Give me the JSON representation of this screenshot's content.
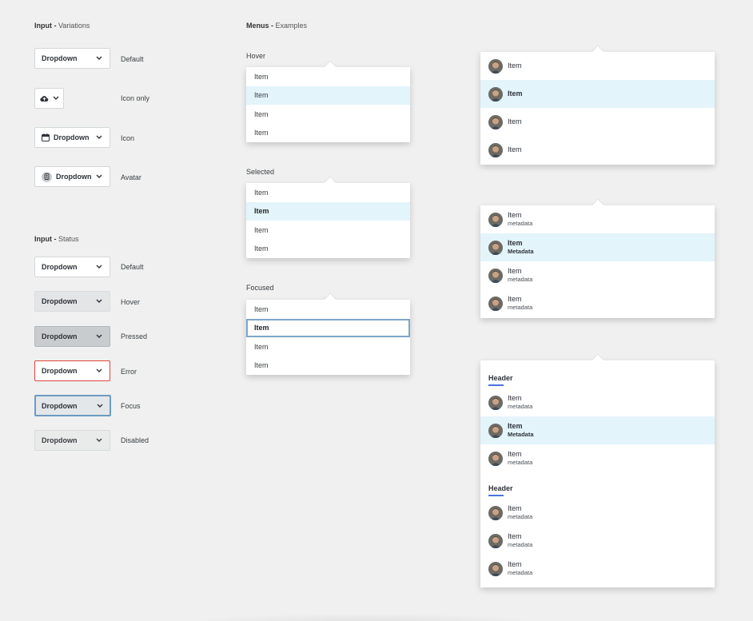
{
  "variations": {
    "title_bold": "Input -",
    "title_rest": " Variations",
    "items": [
      {
        "label": "Default",
        "value": "Dropdown"
      },
      {
        "label": "Icon only",
        "value": ""
      },
      {
        "label": "Icon",
        "value": "Dropdown"
      },
      {
        "label": "Avatar",
        "value": "Dropdown"
      }
    ]
  },
  "status": {
    "title_bold": "Input -",
    "title_rest": " Status",
    "items": [
      {
        "label": "Default",
        "value": "Dropdown",
        "state": "default"
      },
      {
        "label": "Hover",
        "value": "Dropdown",
        "state": "hover"
      },
      {
        "label": "Pressed",
        "value": "Dropdown",
        "state": "pressed"
      },
      {
        "label": "Error",
        "value": "Dropdown",
        "state": "error"
      },
      {
        "label": "Focus",
        "value": "Dropdown",
        "state": "focus"
      },
      {
        "label": "Disabled",
        "value": "Dropdown",
        "state": "disabled"
      }
    ]
  },
  "menus": {
    "title_bold": "Menus -",
    "title_rest": " Examples",
    "hover": {
      "label": "Hover",
      "items": [
        "Item",
        "Item",
        "Item",
        "Item"
      ]
    },
    "selected": {
      "label": "Selected",
      "items": [
        "Item",
        "Item",
        "Item",
        "Item"
      ]
    },
    "focused": {
      "label": "Focused",
      "items": [
        "Item",
        "Item",
        "Item",
        "Item"
      ]
    }
  },
  "avatar_menu": {
    "items": [
      "Item",
      "Item",
      "Item",
      "Item"
    ]
  },
  "meta_menu": {
    "items": [
      {
        "title": "Item",
        "meta": "metadata"
      },
      {
        "title": "Item",
        "meta": "Metadata"
      },
      {
        "title": "Item",
        "meta": "metadata"
      },
      {
        "title": "Item",
        "meta": "metadata"
      }
    ]
  },
  "grouped_menu": {
    "groups": [
      {
        "header": "Header",
        "items": [
          {
            "title": "Item",
            "meta": "metadata"
          },
          {
            "title": "Item",
            "meta": "Metadata"
          },
          {
            "title": "Item",
            "meta": "metadata"
          }
        ]
      },
      {
        "header": "Header",
        "items": [
          {
            "title": "Item",
            "meta": "metadata"
          },
          {
            "title": "Item",
            "meta": "metadata"
          },
          {
            "title": "Item",
            "meta": "metadata"
          }
        ]
      }
    ]
  },
  "icons": {
    "chevron": "chevron-down-icon",
    "cloud": "cloud-upload-icon",
    "calendar": "calendar-icon",
    "avatar": "avatar-icon"
  },
  "colors": {
    "highlight": "#e3f4fb",
    "focus_border": "#6d9bc3",
    "error_border": "#e0433d",
    "header_bar": "#4a73e0"
  }
}
